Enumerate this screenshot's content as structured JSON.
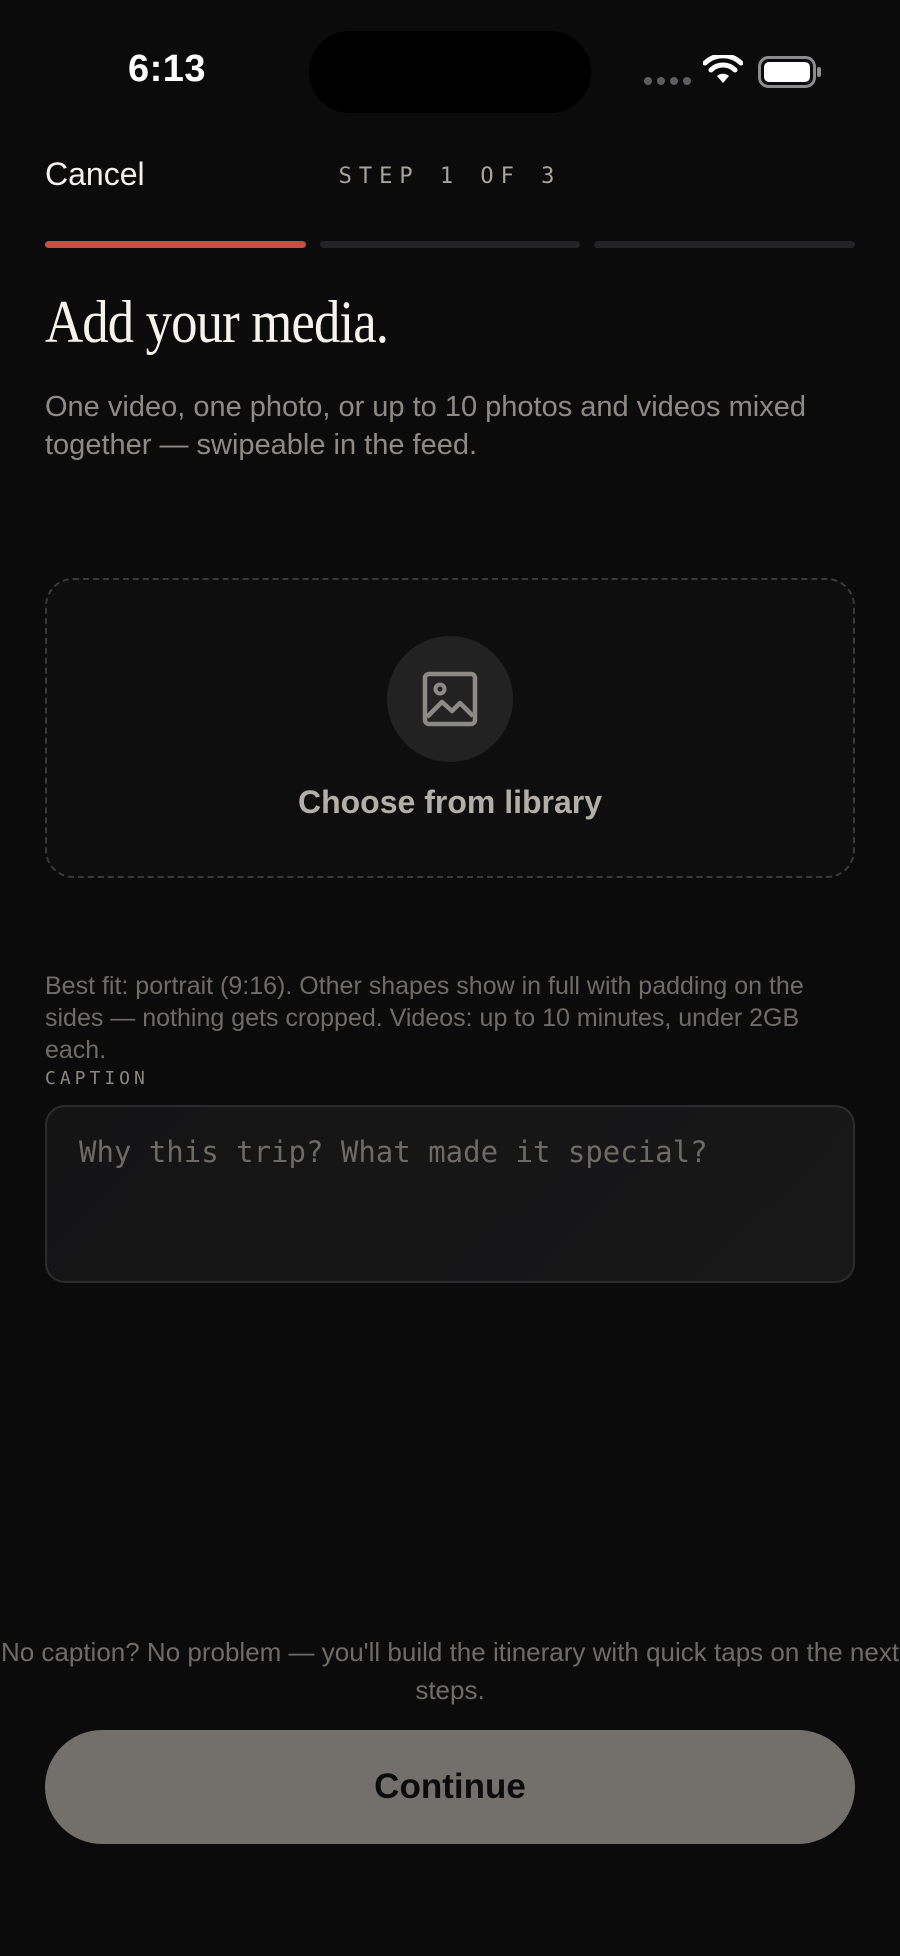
{
  "status_bar": {
    "time": "6:13",
    "icons": [
      "signal-icon",
      "wifi-icon",
      "battery-icon"
    ]
  },
  "nav": {
    "cancel_label": "Cancel",
    "step_label": "STEP 1 OF 3"
  },
  "progress": {
    "current_step": 1,
    "total_steps": 3,
    "active_color": "#c4513f",
    "inactive_color": "#232325"
  },
  "header": {
    "title": "Add your media.",
    "subtitle": "One video, one photo, or up to 10 photos and videos mixed together — swipeable in the feed."
  },
  "dropzone": {
    "icon": "image-icon",
    "label": "Choose from library"
  },
  "hint": "Best fit: portrait (9:16). Other shapes show in full with padding on the sides — nothing gets cropped. Videos: up to 10 minutes, under 2GB each.",
  "caption": {
    "label": "CAPTION",
    "value": "",
    "placeholder": "Why this trip? What made it special?"
  },
  "footer": {
    "note": "No caption? No problem — you'll build the itinerary with quick taps on the next steps.",
    "continue_label": "Continue",
    "continue_color": "#736f6b"
  }
}
